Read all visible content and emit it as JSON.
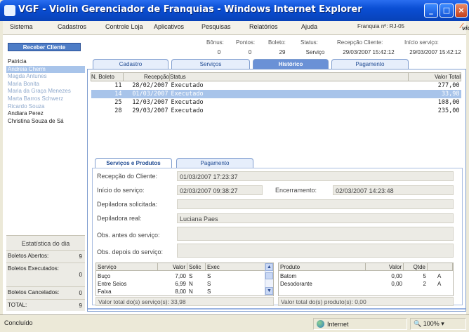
{
  "window": {
    "title": "VGF - Violin Gerenciador de Franquias - Windows Internet Explorer"
  },
  "menu": {
    "items": [
      "Sistema",
      "Cadastros",
      "Controle Loja",
      "Aplicativos",
      "Pesquisas",
      "Relatórios",
      "Ajuda"
    ],
    "franquia": "Franquia nº: RJ-05",
    "logo": "violin"
  },
  "sidebar": {
    "receive_button": "Receber Cliente",
    "clients": [
      {
        "name": "Patricia",
        "state": "normal"
      },
      {
        "name": "Andreia Cherm",
        "state": "selected"
      },
      {
        "name": "Magda Antunes",
        "state": "dim"
      },
      {
        "name": "Maria Bonita",
        "state": "dim"
      },
      {
        "name": "Maria da Graça Menezes",
        "state": "dim"
      },
      {
        "name": "Marta Barros Schwerz",
        "state": "dim"
      },
      {
        "name": "Ricardo Souza",
        "state": "dim"
      },
      {
        "name": "Andiara Perez",
        "state": "normal"
      },
      {
        "name": "Christina Souza de Sá",
        "state": "normal"
      }
    ],
    "stats": {
      "title": "Estatística do dia",
      "rows": [
        {
          "label": "Boletos Abertos:",
          "value": "9"
        },
        {
          "label": "Boletos Executados:",
          "value": "0"
        },
        {
          "label": "Boletos Cancelados:",
          "value": "0"
        },
        {
          "label": "TOTAL:",
          "value": "9"
        }
      ]
    }
  },
  "info": {
    "bonus": {
      "label": "Bônus:",
      "value": "0"
    },
    "pontos": {
      "label": "Pontos:",
      "value": "0"
    },
    "boleto": {
      "label": "Boleto:",
      "value": "29"
    },
    "status": {
      "label": "Status:",
      "value": "Serviço"
    },
    "recepcao": {
      "label": "Recepção Cliente:",
      "value": "29/03/2007 15:42:12"
    },
    "inicio": {
      "label": "Início serviço:",
      "value": "29/03/2007 15:42:12"
    }
  },
  "tabs": [
    "Cadastro",
    "Serviços",
    "Histórico",
    "Pagamento"
  ],
  "boletos": {
    "headers": [
      "N. Boleto",
      "Recepção",
      "Status",
      "Valor Total"
    ],
    "rows": [
      {
        "n": "11",
        "data": "28/02/2007",
        "status": "Executado",
        "valor": "277,00",
        "selected": false
      },
      {
        "n": "14",
        "data": "01/03/2007",
        "status": "Executado",
        "valor": "33,98",
        "selected": true
      },
      {
        "n": "25",
        "data": "12/03/2007",
        "status": "Executado",
        "valor": "108,00",
        "selected": false
      },
      {
        "n": "28",
        "data": "29/03/2007",
        "status": "Executado",
        "valor": "235,00",
        "selected": false
      }
    ]
  },
  "subtabs": [
    "Serviços e Produtos",
    "Pagamento"
  ],
  "details": {
    "recepcao_label": "Recepção do Cliente:",
    "recepcao_value": "01/03/2007 17:23:37",
    "inicio_label": "Início do serviço:",
    "inicio_value": "02/03/2007 09:38:27",
    "encerramento_label": "Encerramento:",
    "encerramento_value": "02/03/2007 14:23:48",
    "dep_solicitada_label": "Depiladora solicitada:",
    "dep_solicitada_value": "",
    "dep_real_label": "Depiladora real:",
    "dep_real_value": "Luciana Paes",
    "obs_antes_label": "Obs. antes do serviço:",
    "obs_depois_label": "Obs. depois do serviço:"
  },
  "servicos": {
    "headers": [
      "Serviço",
      "Valor",
      "Solic",
      "Exec"
    ],
    "rows": [
      [
        "Buço",
        "7,00",
        "S",
        "S"
      ],
      [
        "Entre Seios",
        "6,99",
        "N",
        "S"
      ],
      [
        "Faixa",
        "8,00",
        "N",
        "S"
      ]
    ],
    "total": "Valor total do(s) serviço(s): 33,98"
  },
  "produtos": {
    "headers": [
      "Produto",
      "Valor",
      "Qtde",
      ""
    ],
    "rows": [
      [
        "Batom",
        "0,00",
        "5",
        "A"
      ],
      [
        "Desodorante",
        "0,00",
        "2",
        "A"
      ]
    ],
    "total": "Valor total do(s) produto(s): 0,00"
  },
  "statusbar": {
    "left": "Concluído",
    "zone": "Internet",
    "zoom": "100%"
  }
}
